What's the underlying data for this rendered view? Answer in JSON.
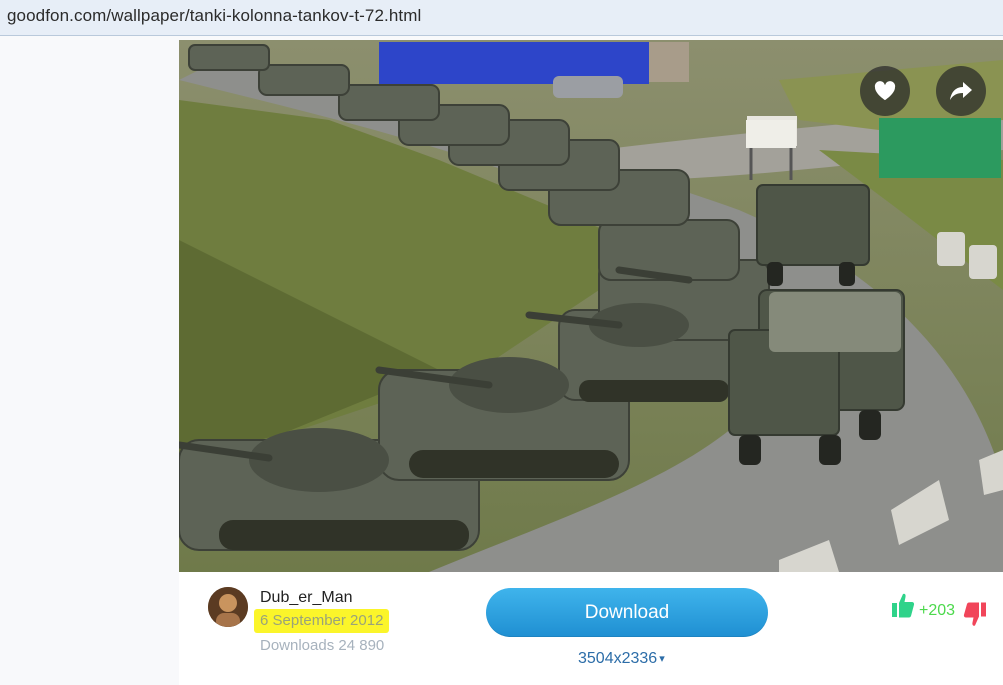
{
  "browser": {
    "url": "goodfon.com/wallpaper/tanki-kolonna-tankov-t-72.html"
  },
  "photo": {
    "actions": {
      "favorite_icon": "heart-icon",
      "share_icon": "share-arrow-icon"
    }
  },
  "author": {
    "name": "Dub_er_Man",
    "date": "6 September 2012",
    "downloads": "Downloads 24 890"
  },
  "download": {
    "label": "Download",
    "resolution": "3504x2336",
    "resolution_arrow": "▾"
  },
  "rating": {
    "likes": "+203",
    "like_icon": "thumbs-up-icon",
    "dislike_icon": "thumbs-down-icon",
    "like_color": "#2fd38a",
    "dislike_color": "#f1455a"
  },
  "colors": {
    "download_button": "#2aa3e2",
    "date_highlight": "#fbf52a",
    "likes_text": "#4cd94c"
  }
}
